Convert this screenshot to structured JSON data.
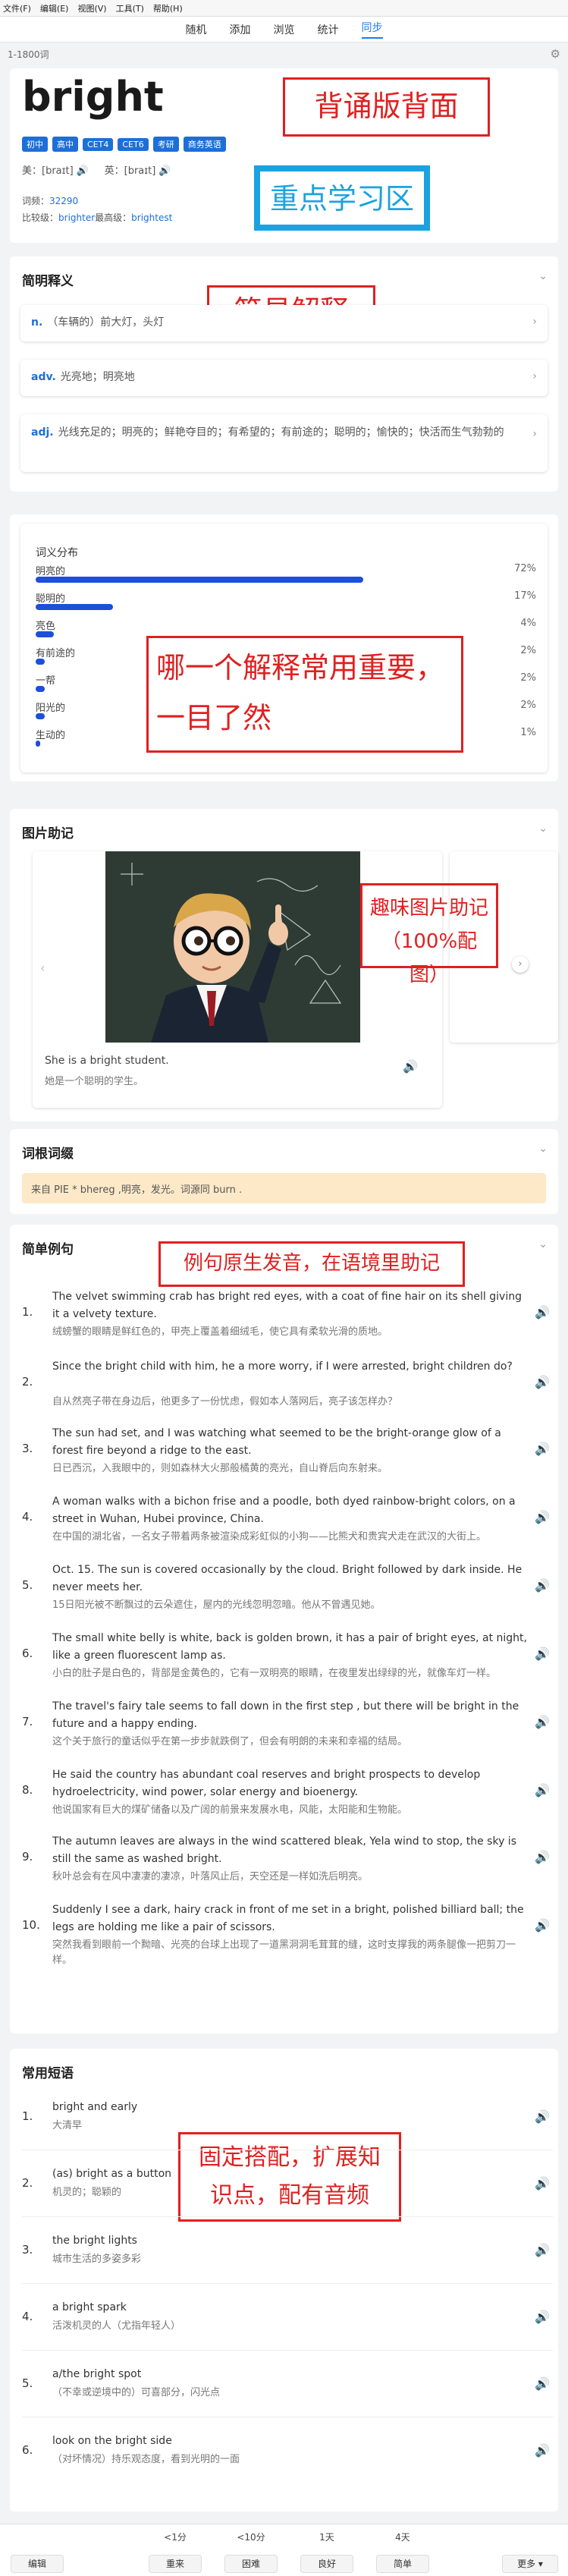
{
  "menubar": [
    "文件(F)",
    "编辑(E)",
    "视图(V)",
    "工具(T)",
    "帮助(H)"
  ],
  "nav": {
    "tabs": [
      "随机",
      "添加",
      "浏览",
      "统计",
      "同步"
    ],
    "active_index": 4
  },
  "crumb": "1-1800词",
  "word": {
    "headword": "bright",
    "tags": [
      "初中",
      "高中",
      "CET4",
      "CET6",
      "考研",
      "商务英语"
    ],
    "us_label": "美：[braɪt]",
    "uk_label": "英：[braɪt]",
    "freq_label": "词频：",
    "freq_value": "32290",
    "compare_label": "比较级：",
    "compare_value": "brighter",
    "superlative_label": "最高级：",
    "superlative_value": "brightest"
  },
  "annotations": {
    "a1": "背诵版背面",
    "a2": "重点学习区",
    "a3": "简易解释",
    "a4": "哪一个解释常用重要，一目了然",
    "a5": "趣味图片助记（100%配图）",
    "a6": "例句原生发音，在语境里助记",
    "a7": "固定搭配，扩展知识点，配有音频"
  },
  "simple_def": {
    "title": "简明释义",
    "items": [
      {
        "pos": "n.",
        "text": "（车辆的）前大灯，头灯"
      },
      {
        "pos": "adv.",
        "text": "光亮地；明亮地"
      },
      {
        "pos": "adj.",
        "text": "光线充足的；明亮的；鲜艳夺目的；有希望的；有前途的；聪明的；愉快的；快活而生气勃勃的"
      }
    ]
  },
  "distribution": {
    "title": "词义分布",
    "rows": [
      {
        "label": "明亮的",
        "pct": "72%",
        "value": 0.72
      },
      {
        "label": "聪明的",
        "pct": "17%",
        "value": 0.17
      },
      {
        "label": "亮色",
        "pct": "4%",
        "value": 0.04
      },
      {
        "label": "有前途的",
        "pct": "2%",
        "value": 0.02
      },
      {
        "label": "一帮",
        "pct": "2%",
        "value": 0.02
      },
      {
        "label": "阳光的",
        "pct": "2%",
        "value": 0.02
      },
      {
        "label": "生动的",
        "pct": "1%",
        "value": 0.01
      }
    ]
  },
  "picture": {
    "title": "图片助记",
    "caption_en": "She is a bright student.",
    "caption_cn": "她是一个聪明的学生。"
  },
  "roots": {
    "title": "词根词缀",
    "text": "来自 PIE * bhereg ,明亮，发光。词源同 burn ."
  },
  "examples": {
    "title": "简单例句",
    "items": [
      {
        "n": "1.",
        "en": "The velvet swimming crab has bright red eyes, with a coat of fine hair on its shell giving it a velvety texture.",
        "cn": "绒螃蟹的眼睛是鲜红色的，甲壳上覆盖着细绒毛，使它具有柔软光滑的质地。"
      },
      {
        "n": "2.",
        "en": "Since the bright child with him, he a more worry, if I were arrested, bright children do?",
        "cn": "自从然亮子带在身边后，他更多了一份忧虑，假如本人落网后，亮子该怎样办？"
      },
      {
        "n": "3.",
        "en": "The sun had set, and I was watching what seemed to be the bright-orange glow of a forest fire beyond a ridge to the east.",
        "cn": "日已西沉，入我眼中的，则如森林大火那般橘黄的亮光，自山脊后向东射来。"
      },
      {
        "n": "4.",
        "en": "A woman walks with a bichon frise and a poodle, both dyed rainbow-bright colors, on a street in Wuhan, Hubei province, China.",
        "cn": "在中国的湖北省，一名女子带着两条被渲染成彩虹似的小狗——比熊犬和贵宾犬走在武汉的大街上。"
      },
      {
        "n": "5.",
        "en": "Oct. 15. The sun is covered occasionally by the cloud. Bright followed by dark inside. He never meets her.",
        "cn": "15日阳光被不断飘过的云朵遮住，屋内的光线忽明忽暗。他从不曾遇见她。"
      },
      {
        "n": "6.",
        "en": "The small white belly is white, back is golden brown, it has a pair of bright eyes, at night, like a green fluorescent lamp as.",
        "cn": "小白的肚子是白色的，背部是金黄色的，它有一双明亮的眼睛，在夜里发出绿绿的光，就像车灯一样。"
      },
      {
        "n": "7.",
        "en": "The travel's fairy tale seems to fall down in the first step , but there will be bright in the future and a happy ending.",
        "cn": "这个关于旅行的童话似乎在第一步步就跌倒了，但会有明朗的未来和幸福的结局。"
      },
      {
        "n": "8.",
        "en": "He said the country has abundant coal reserves and bright prospects to develop hydroelectricity, wind power, solar energy and bioenergy.",
        "cn": "他说国家有巨大的煤矿储备以及广阔的前景来发展水电，风能，太阳能和生物能。"
      },
      {
        "n": "9.",
        "en": "The autumn leaves are always in the wind scattered bleak, Yela wind to stop, the sky is still the same as washed bright.",
        "cn": "秋叶总会有在风中凄凄的凄凉，叶落风止后，天空还是一样如洗后明亮。"
      },
      {
        "n": "10.",
        "en": "Suddenly I see a dark, hairy crack in front of me set in a bright, polished billiard ball; the legs are holding me like a pair of scissors.",
        "cn": "突然我看到眼前一个黝暗、光亮的台球上出现了一道黑洞洞毛茸茸的缝，这时支撑我的两条腿像一把剪刀一样。"
      }
    ]
  },
  "phrases": {
    "title": "常用短语",
    "items": [
      {
        "n": "1.",
        "en": "bright and early",
        "cn": "大清早"
      },
      {
        "n": "2.",
        "en": "(as) bright as a button",
        "cn": "机灵的；聪颖的"
      },
      {
        "n": "3.",
        "en": "the bright lights",
        "cn": "城市生活的多姿多彩"
      },
      {
        "n": "4.",
        "en": "a bright spark",
        "cn": "活泼机灵的人（尤指年轻人）"
      },
      {
        "n": "5.",
        "en": "a/the bright spot",
        "cn": "（不幸或逆境中的）可喜部分，闪光点"
      },
      {
        "n": "6.",
        "en": "look on the bright side",
        "cn": "（对坏情况）持乐观态度，看到光明的一面"
      }
    ]
  },
  "bottom": {
    "edit": "编辑",
    "more": "更多",
    "intervals": [
      "<1分",
      "<10分",
      "1天",
      "4天"
    ],
    "buttons": [
      "重来",
      "困难",
      "良好",
      "简单"
    ]
  },
  "colors": {
    "accent": "#1d6fd8",
    "annotation_red": "#e02020",
    "annotation_blue": "#1aa3e0",
    "roots_bg": "#fde9c8"
  }
}
